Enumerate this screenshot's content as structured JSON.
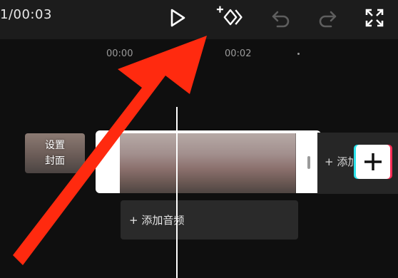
{
  "toolbar": {
    "time_display": "1/00:03",
    "icons": [
      "play-icon",
      "add-keyframe-icon",
      "undo-icon",
      "redo-icon",
      "fullscreen-icon"
    ]
  },
  "timeline": {
    "ruler": [
      "00:00",
      "00:02"
    ],
    "cover_label_line1": "设置",
    "cover_label_line2": "封面",
    "add_clip_label": "添加",
    "add_audio_label": "添加音频"
  },
  "colors": {
    "background": "#0f0f0f",
    "toolbar": "#1c1c1c",
    "arrow": "#ff2a0f",
    "tiktok_cyan": "#2de3ec",
    "tiktok_red": "#fe2c55"
  }
}
